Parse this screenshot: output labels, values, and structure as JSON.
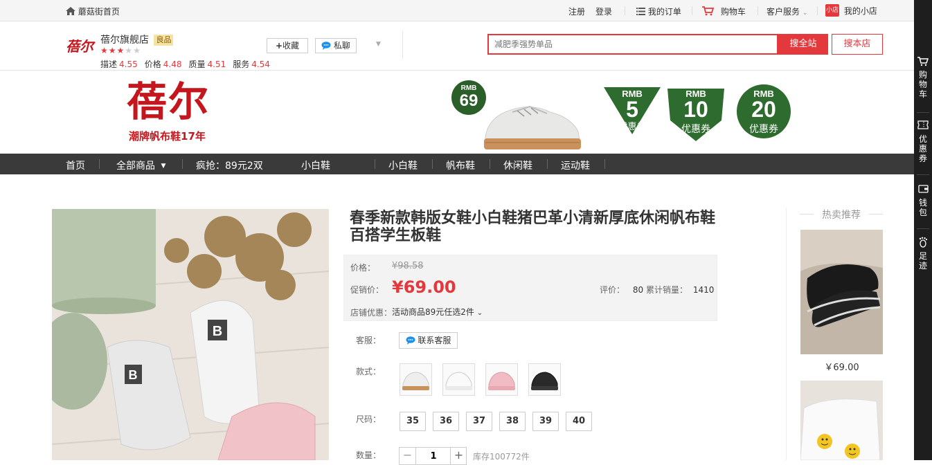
{
  "topbar": {
    "home": "蘑菇街首页",
    "register": "注册",
    "login": "登录",
    "orders": "我的订单",
    "cart": "购物车",
    "service": "客户服务",
    "shop_badge": "小店",
    "my_shop": "我的小店"
  },
  "shop": {
    "logo_text": "蓓尔",
    "name": "蓓尔旗舰店",
    "quality_badge": "良品",
    "stars": 3,
    "scores": [
      {
        "label": "描述",
        "value": "4.55"
      },
      {
        "label": "价格",
        "value": "4.48"
      },
      {
        "label": "质量",
        "value": "4.51"
      },
      {
        "label": "服务",
        "value": "4.54"
      }
    ],
    "favorite": "收藏",
    "chat": "私聊"
  },
  "search": {
    "placeholder": "减肥季强势单品",
    "btn_all": "搜全站",
    "btn_shop": "搜本店"
  },
  "banner": {
    "brand": "蓓尔",
    "tagline": "潮牌帆布鞋17年",
    "price_badge_top": "RMB",
    "price_badge_value": "69",
    "coupons": [
      {
        "top": "RMB",
        "value": "5",
        "label": "优惠券"
      },
      {
        "top": "RMB",
        "value": "10",
        "label": "优惠券"
      },
      {
        "top": "RMB",
        "value": "20",
        "label": "优惠券"
      }
    ]
  },
  "nav": {
    "items": [
      "首页",
      "全部商品",
      "疯抢：89元2双",
      "小白鞋",
      "小白鞋",
      "帆布鞋",
      "休闲鞋",
      "运动鞋"
    ]
  },
  "product": {
    "title": "春季新款韩版女鞋小白鞋猪巴革小清新厚底休闲帆布鞋百搭学生板鞋",
    "price_label": "价格：",
    "original_price": "¥98.58",
    "promo_label": "促销价：",
    "promo_price": "¥69.00",
    "rating_label": "评价：",
    "rating_count": "80",
    "sales_label": "累计销量：",
    "sales_count": "1410",
    "shop_promo_label": "店铺优惠：",
    "shop_promo_value": "活动商品89元任选2件",
    "service_label": "客服：",
    "service_btn": "联系客服",
    "style_label": "款式：",
    "styles": [
      "白色",
      "白色皮面",
      "粉色",
      "黑色"
    ],
    "size_label": "尺码：",
    "sizes": [
      "35",
      "36",
      "37",
      "38",
      "39",
      "40"
    ],
    "qty_label": "数量：",
    "qty_value": "1",
    "stock": "库存100772件"
  },
  "hot": {
    "title": "热卖推荐",
    "items": [
      {
        "price": "￥69.00"
      }
    ]
  },
  "rightbar": {
    "items": [
      "购物车",
      "优惠券",
      "钱包",
      "足迹"
    ]
  },
  "colors": {
    "accent": "#e4393c",
    "nav_bg": "#3a3a3a",
    "brand_red": "#c4161c",
    "badge_green": "#2e6b2e"
  }
}
